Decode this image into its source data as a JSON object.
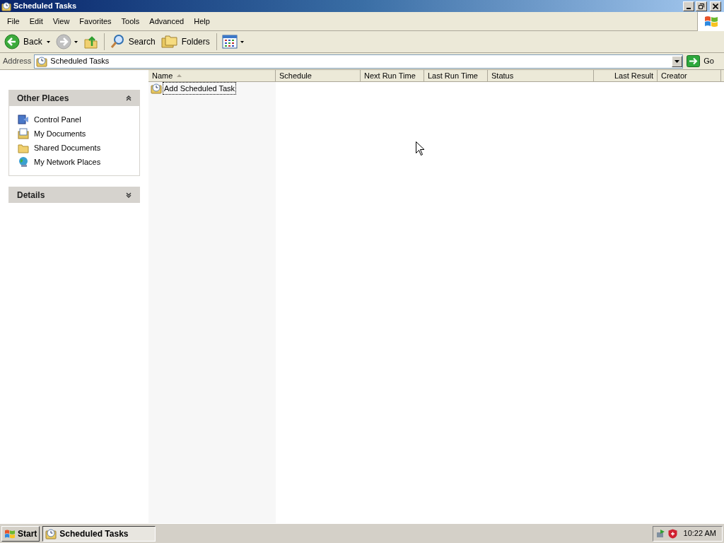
{
  "window": {
    "title": "Scheduled Tasks"
  },
  "menu": [
    "File",
    "Edit",
    "View",
    "Favorites",
    "Tools",
    "Advanced",
    "Help"
  ],
  "toolbar": [
    {
      "kind": "back",
      "label": "Back",
      "disabled": false
    },
    {
      "kind": "forward",
      "disabled": true
    },
    {
      "kind": "up"
    },
    {
      "kind": "search",
      "label": "Search"
    },
    {
      "kind": "folders",
      "label": "Folders"
    },
    {
      "kind": "views"
    }
  ],
  "address": {
    "label": "Address",
    "value": "Scheduled Tasks",
    "go": "Go"
  },
  "panels": [
    {
      "title": "Other Places",
      "expanded": true,
      "items": [
        {
          "kind": "control-panel",
          "label": "Control Panel"
        },
        {
          "kind": "documents",
          "label": "My Documents"
        },
        {
          "kind": "folder",
          "label": "Shared Documents"
        },
        {
          "kind": "network",
          "label": "My Network Places"
        }
      ]
    },
    {
      "title": "Details",
      "expanded": false
    }
  ],
  "table": {
    "columns": [
      {
        "label": "Name",
        "sorted": true
      },
      {
        "label": "Schedule",
        "sorted": false
      },
      {
        "label": "Next Run Time",
        "sorted": false
      },
      {
        "label": "Last Run Time",
        "sorted": false
      },
      {
        "label": "Status",
        "sorted": false
      },
      {
        "label": "Last Result",
        "sorted": false
      },
      {
        "label": "Creator",
        "sorted": false
      }
    ],
    "rows": [
      {
        "name": "Add Scheduled Task",
        "focused": true
      }
    ]
  },
  "taskbar": {
    "start": "Start",
    "tasks": [
      {
        "label": "Scheduled Tasks",
        "selected": true
      }
    ],
    "clock": "10:22 AM"
  }
}
